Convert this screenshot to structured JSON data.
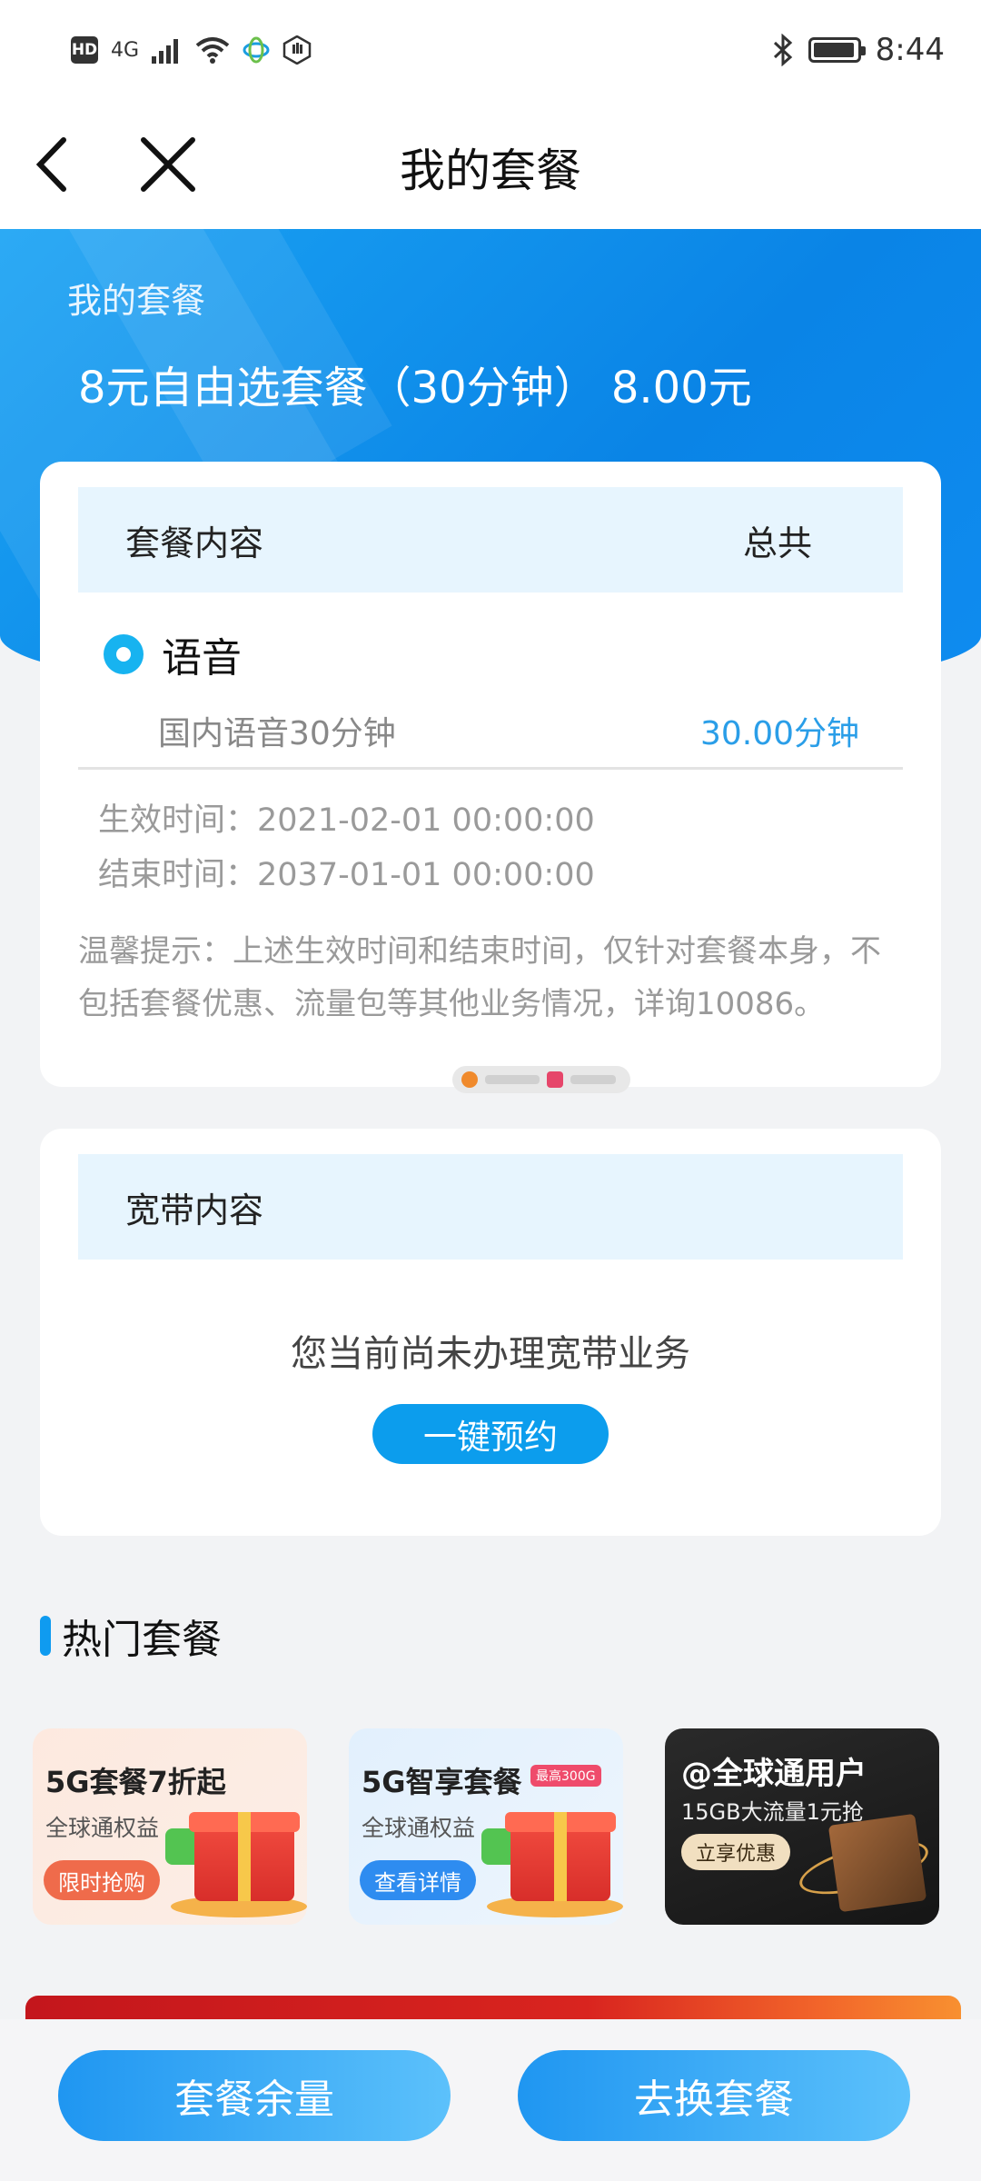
{
  "status_bar": {
    "hd": "HD",
    "network": "4G",
    "time": "8:44"
  },
  "nav": {
    "title": "我的套餐"
  },
  "hero": {
    "label": "我的套餐",
    "plan": "8元自由选套餐（30分钟） 8.00元"
  },
  "package_card": {
    "header_left": "套餐内容",
    "header_right": "总共",
    "category": "语音",
    "item_name": "国内语音30分钟",
    "item_amount": "30.00分钟",
    "effective_time_label": "生效时间：",
    "effective_time": "2021-02-01 00:00:00",
    "end_time_label": "结束时间：",
    "end_time": "2037-01-01 00:00:00",
    "tip": "温馨提示：上述生效时间和结束时间，仅针对套餐本身，不包括套餐优惠、流量包等其他业务情况，详询10086。"
  },
  "broadband_card": {
    "header": "宽带内容",
    "empty_text": "您当前尚未办理宽带业务",
    "reserve_button": "一键预约"
  },
  "hot": {
    "title": "热门套餐",
    "promos": [
      {
        "title": "5G套餐7折起",
        "subtitle": "全球通权益",
        "button": "限时抢购"
      },
      {
        "title": "5G智享套餐",
        "subtitle": "全球通权益",
        "badge": "最高300G",
        "button": "查看详情"
      },
      {
        "title": "@全球通用户",
        "subtitle": "15GB大流量1元抢",
        "button": "立享优惠"
      }
    ]
  },
  "bottom": {
    "left_button": "套餐余量",
    "right_button": "去换套餐"
  },
  "colors": {
    "primary_blue": "#0c9ded",
    "hero_blue": "#1ba3f3",
    "amount_blue": "#2a9ee8"
  },
  "icons": [
    "back-icon",
    "close-icon",
    "wifi-icon",
    "signal-icon",
    "bluetooth-icon",
    "battery-icon",
    "radio-dot-icon"
  ]
}
